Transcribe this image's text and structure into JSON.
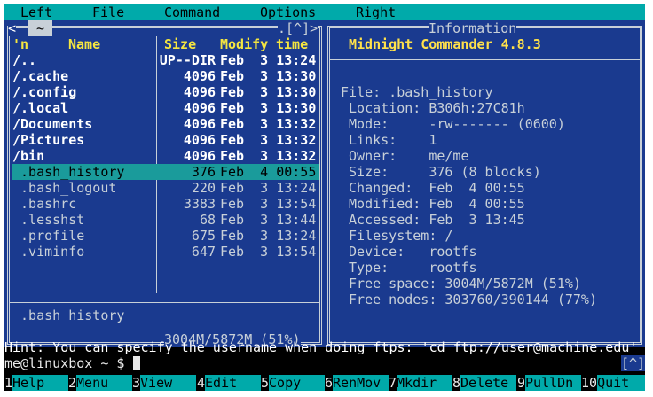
{
  "menu": {
    "left": "Left",
    "file": "File",
    "command": "Command",
    "options": "Options",
    "right": "Right"
  },
  "left_panel": {
    "corner_marker": "<",
    "home_tab": "~",
    "scroll_marker": ".[^]>",
    "sort_indicator": "'n",
    "headers": {
      "name": "Name",
      "size": "Size",
      "modify": "Modify",
      "time": "time"
    },
    "rows": [
      {
        "name": "/..",
        "size": "UP--DIR",
        "modify": "Feb  3 13:24"
      },
      {
        "name": "/.cache",
        "size": "4096",
        "modify": "Feb  3 13:30"
      },
      {
        "name": "/.config",
        "size": "4096",
        "modify": "Feb  3 13:30"
      },
      {
        "name": "/.local",
        "size": "4096",
        "modify": "Feb  3 13:30"
      },
      {
        "name": "/Documents",
        "size": "4096",
        "modify": "Feb  3 13:32"
      },
      {
        "name": "/Pictures",
        "size": "4096",
        "modify": "Feb  3 13:32"
      },
      {
        "name": "/bin",
        "size": "4096",
        "modify": "Feb  3 13:32"
      },
      {
        "name": " .bash_history",
        "size": "376",
        "modify": "Feb  4 00:55"
      },
      {
        "name": " .bash_logout",
        "size": "220",
        "modify": "Feb  3 13:24"
      },
      {
        "name": " .bashrc",
        "size": "3383",
        "modify": "Feb  3 13:54"
      },
      {
        "name": " .lesshst",
        "size": "68",
        "modify": "Feb  3 13:44"
      },
      {
        "name": " .profile",
        "size": "675",
        "modify": "Feb  3 13:24"
      },
      {
        "name": " .viminfo",
        "size": "647",
        "modify": "Feb  3 13:54"
      }
    ],
    "selected_index": 7,
    "mini_status": " .bash_history",
    "disk_usage": "3004M/5872M (51%)"
  },
  "right_panel": {
    "panel_title": "Information",
    "app_title": "Midnight Commander 4.8.3",
    "lines": [
      "File: .bash_history",
      " Location: B306h:27C81h",
      " Mode:     -rw------- (0600)",
      " Links:    1",
      " Owner:    me/me",
      " Size:     376 (8 blocks)",
      " Changed:  Feb  4 00:55",
      " Modified: Feb  4 00:55",
      " Accessed: Feb  3 13:45",
      " Filesystem: /",
      " Device:   rootfs",
      " Type:     rootfs",
      " Free space: 3004M/5872M (51%)",
      " Free nodes: 303760/390144 (77%)"
    ]
  },
  "hint": "Hint: You can specify the username when doing ftps: 'cd ftp://user@machine.edu'",
  "prompt": "me@linuxbox ~ $ ",
  "prompt_right_marker": "[^]",
  "fkeys": [
    {
      "num": "1",
      "label": "Help"
    },
    {
      "num": "2",
      "label": "Menu"
    },
    {
      "num": "3",
      "label": "View"
    },
    {
      "num": "4",
      "label": "Edit"
    },
    {
      "num": "5",
      "label": "Copy"
    },
    {
      "num": "6",
      "label": "RenMov"
    },
    {
      "num": "7",
      "label": "Mkdir"
    },
    {
      "num": "8",
      "label": "Delete"
    },
    {
      "num": "9",
      "label": "PullDn"
    },
    {
      "num": "10",
      "label": "Quit"
    }
  ],
  "colors": {
    "panel_bg": "#1a3a8f",
    "menubar_bg": "#00aaaa",
    "selection_bg": "#1a9b9b",
    "header_fg": "#f5e640"
  }
}
